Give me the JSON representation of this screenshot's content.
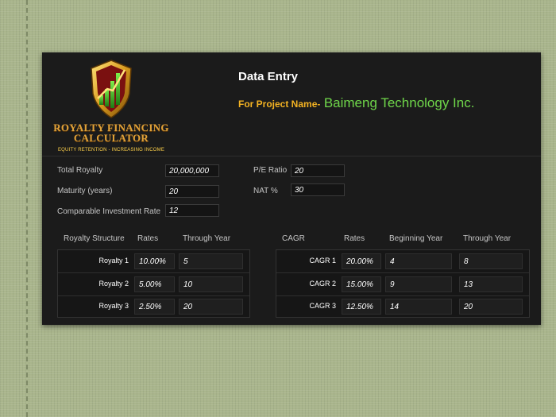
{
  "logo": {
    "title_line1": "ROYALTY FINANCING",
    "title_line2": "CALCULATOR",
    "tagline": "EQUITY RETENTION - INCREASING INCOME"
  },
  "header": {
    "title": "Data Entry",
    "project_label": "For Project Name-",
    "project_name": "Baimeng Technology Inc."
  },
  "fields": {
    "total_royalty": {
      "label": "Total Royalty",
      "value": "20,000,000"
    },
    "maturity": {
      "label": "Maturity (years)",
      "value": "20"
    },
    "comparable_rate": {
      "label": "Comparable Investment Rate",
      "value": "12"
    },
    "pe_ratio": {
      "label": "P/E Ratio",
      "value": "20"
    },
    "nat": {
      "label": "NAT %",
      "value": "30"
    }
  },
  "royalty_table": {
    "headers": [
      "Royalty Structure",
      "Rates",
      "Through Year"
    ],
    "rows": [
      {
        "label": "Royalty 1",
        "rate": "10.00%",
        "through": "5"
      },
      {
        "label": "Royalty 2",
        "rate": "5.00%",
        "through": "10"
      },
      {
        "label": "Royalty 3",
        "rate": "2.50%",
        "through": "20"
      }
    ]
  },
  "cagr_table": {
    "headers": [
      "CAGR",
      "Rates",
      "Beginning Year",
      "Through Year"
    ],
    "rows": [
      {
        "label": "CAGR 1",
        "rate": "20.00%",
        "begin": "4",
        "through": "8"
      },
      {
        "label": "CAGR 2",
        "rate": "15.00%",
        "begin": "9",
        "through": "13"
      },
      {
        "label": "CAGR 3",
        "rate": "12.50%",
        "begin": "14",
        "through": "20"
      }
    ]
  },
  "colors": {
    "panel_bg": "#1b1b1b",
    "page_bg": "#a9b58c",
    "accent_orange": "#f4b322",
    "accent_green": "#6fd64a"
  }
}
